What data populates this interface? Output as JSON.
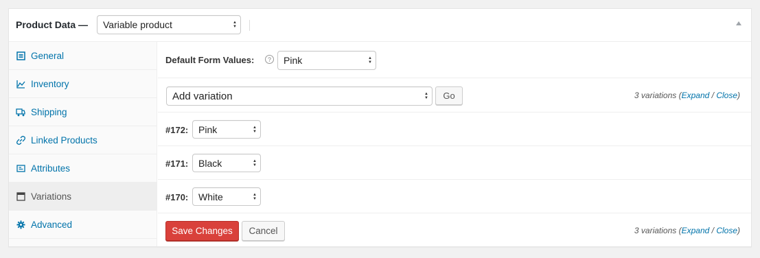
{
  "header": {
    "title": "Product Data —",
    "product_type": "Variable product"
  },
  "tabs": [
    {
      "label": "General",
      "icon": "general-icon"
    },
    {
      "label": "Inventory",
      "icon": "inventory-icon"
    },
    {
      "label": "Shipping",
      "icon": "shipping-icon"
    },
    {
      "label": "Linked Products",
      "icon": "link-icon"
    },
    {
      "label": "Attributes",
      "icon": "attributes-icon"
    },
    {
      "label": "Variations",
      "icon": "variations-icon"
    },
    {
      "label": "Advanced",
      "icon": "gear-icon"
    }
  ],
  "default_form": {
    "label": "Default Form Values:",
    "help": "?",
    "value": "Pink"
  },
  "add_variation": {
    "select_value": "Add variation",
    "go_label": "Go"
  },
  "variation_count": {
    "prefix": "3 variations (",
    "expand": "Expand",
    "sep": " / ",
    "close": "Close",
    "suffix": ")"
  },
  "variations": [
    {
      "id": "#172:",
      "value": "Pink"
    },
    {
      "id": "#171:",
      "value": "Black"
    },
    {
      "id": "#170:",
      "value": "White"
    }
  ],
  "footer": {
    "save_label": "Save Changes",
    "cancel_label": "Cancel"
  },
  "colors": {
    "link": "#0073aa",
    "primary_button": "#d9413b"
  }
}
